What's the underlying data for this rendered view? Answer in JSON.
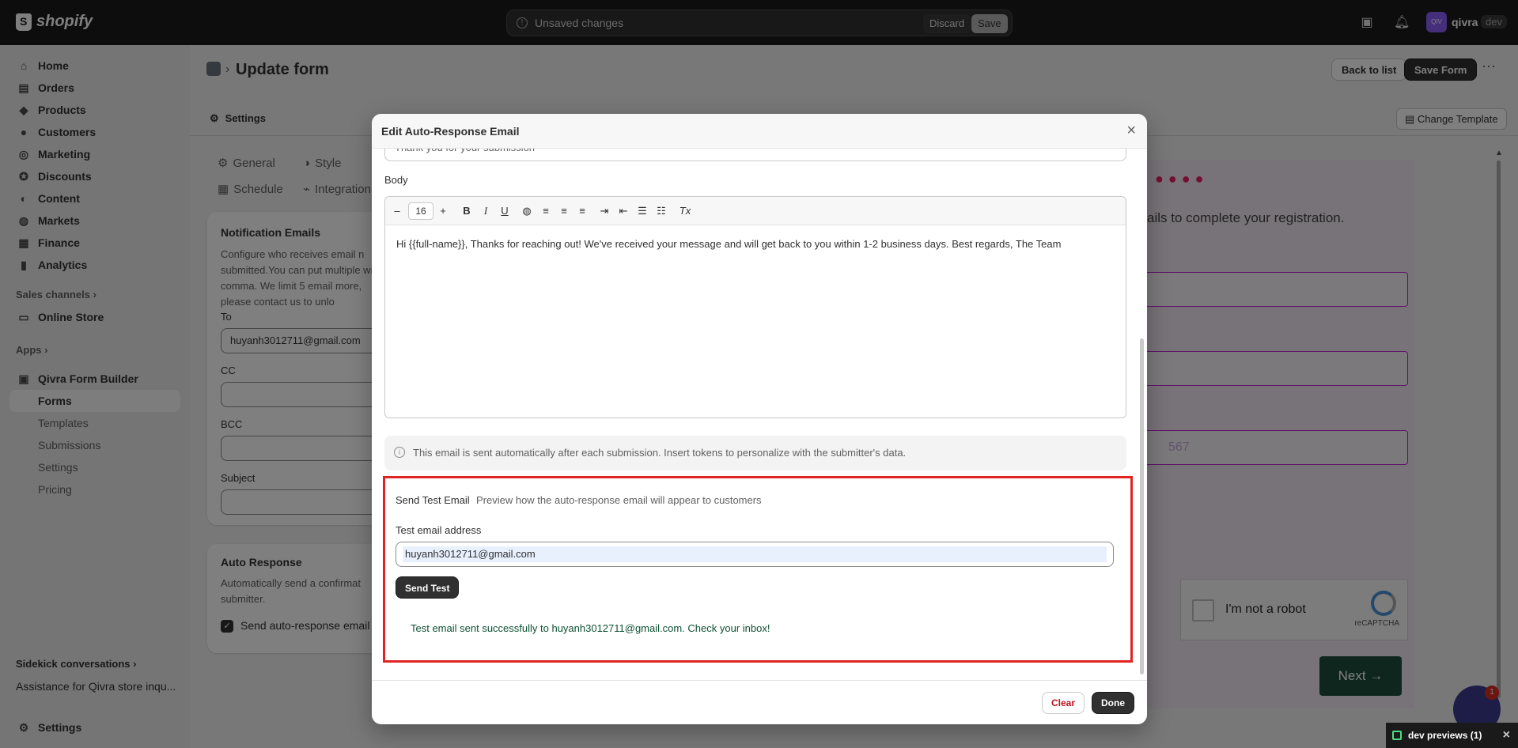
{
  "topbar": {
    "brand": "shopify",
    "unsaved_label": "Unsaved changes",
    "discard_label": "Discard",
    "save_label": "Save",
    "avatar_text": "QIV",
    "store_name": "qivra",
    "store_badge": "dev"
  },
  "sidebar": {
    "items": [
      {
        "label": "Home",
        "icon": "home-icon"
      },
      {
        "label": "Orders",
        "icon": "orders-icon"
      },
      {
        "label": "Products",
        "icon": "tag-icon"
      },
      {
        "label": "Customers",
        "icon": "person-icon"
      },
      {
        "label": "Marketing",
        "icon": "target-icon"
      },
      {
        "label": "Discounts",
        "icon": "discount-icon"
      },
      {
        "label": "Content",
        "icon": "content-icon"
      },
      {
        "label": "Markets",
        "icon": "globe-icon"
      },
      {
        "label": "Finance",
        "icon": "bank-icon"
      },
      {
        "label": "Analytics",
        "icon": "chart-icon"
      }
    ],
    "sales_channels": "Sales channels",
    "online_store": "Online Store",
    "apps": "Apps",
    "app_name": "Qivra Form Builder",
    "app_sub": [
      "Forms",
      "Templates",
      "Submissions",
      "Settings",
      "Pricing"
    ],
    "sidekick_heading": "Sidekick conversations",
    "sidekick_item": "Assistance for Qivra store inqu...",
    "settings": "Settings"
  },
  "header": {
    "title": "Update form",
    "back_label": "Back to list",
    "save_form_label": "Save Form"
  },
  "tabs": {
    "settings": "Settings",
    "change_template": "Change Template"
  },
  "left_panel": {
    "pills": [
      "General",
      "Style",
      "Schedule",
      "Integration"
    ],
    "notif_title": "Notification Emails",
    "notif_desc": "Configure who receives email n submitted.You can put multiple with a comma. We limit 5 email more, please contact us to unlo",
    "to_label": "To",
    "to_value": "huyanh3012711@gmail.com",
    "cc_label": "CC",
    "bcc_label": "BCC",
    "subject_label": "Subject",
    "auto_title": "Auto Response",
    "auto_desc": "Automatically send a confirmat submitter.",
    "auto_checkbox": "Send auto-response email"
  },
  "preview": {
    "registration_text": "ails to complete your registration.",
    "phone_placeholder": "567",
    "captcha_text": "I'm not a robot",
    "captcha_brand": "reCAPTCHA",
    "next_label": "Next →"
  },
  "modal": {
    "title": "Edit Auto-Response Email",
    "subject_partial": "Thank you for your submission",
    "body_label": "Body",
    "font_size": "16",
    "body_text": "Hi {{full-name}}, Thanks for reaching out! We've received your message and will get back to you within 1-2 business days. Best regards, The Team",
    "info_text": "This email is sent automatically after each submission. Insert tokens to personalize with the submitter's data.",
    "test_title": "Send Test Email",
    "test_subtitle": "Preview how the auto-response email will appear to customers",
    "test_label": "Test email address",
    "test_value": "huyanh3012711@gmail.com",
    "send_test_label": "Send Test",
    "success_text": "Test email sent successfully to huyanh3012711@gmail.com. Check your inbox!",
    "clear_label": "Clear",
    "done_label": "Done"
  },
  "footer": {
    "dev_previews": "dev previews",
    "dev_count": "(1)",
    "chat_badge": "1"
  },
  "colors": {
    "highlight_border": "#e02424",
    "success_text": "#0c5132",
    "next_button": "#1f4d3f"
  }
}
